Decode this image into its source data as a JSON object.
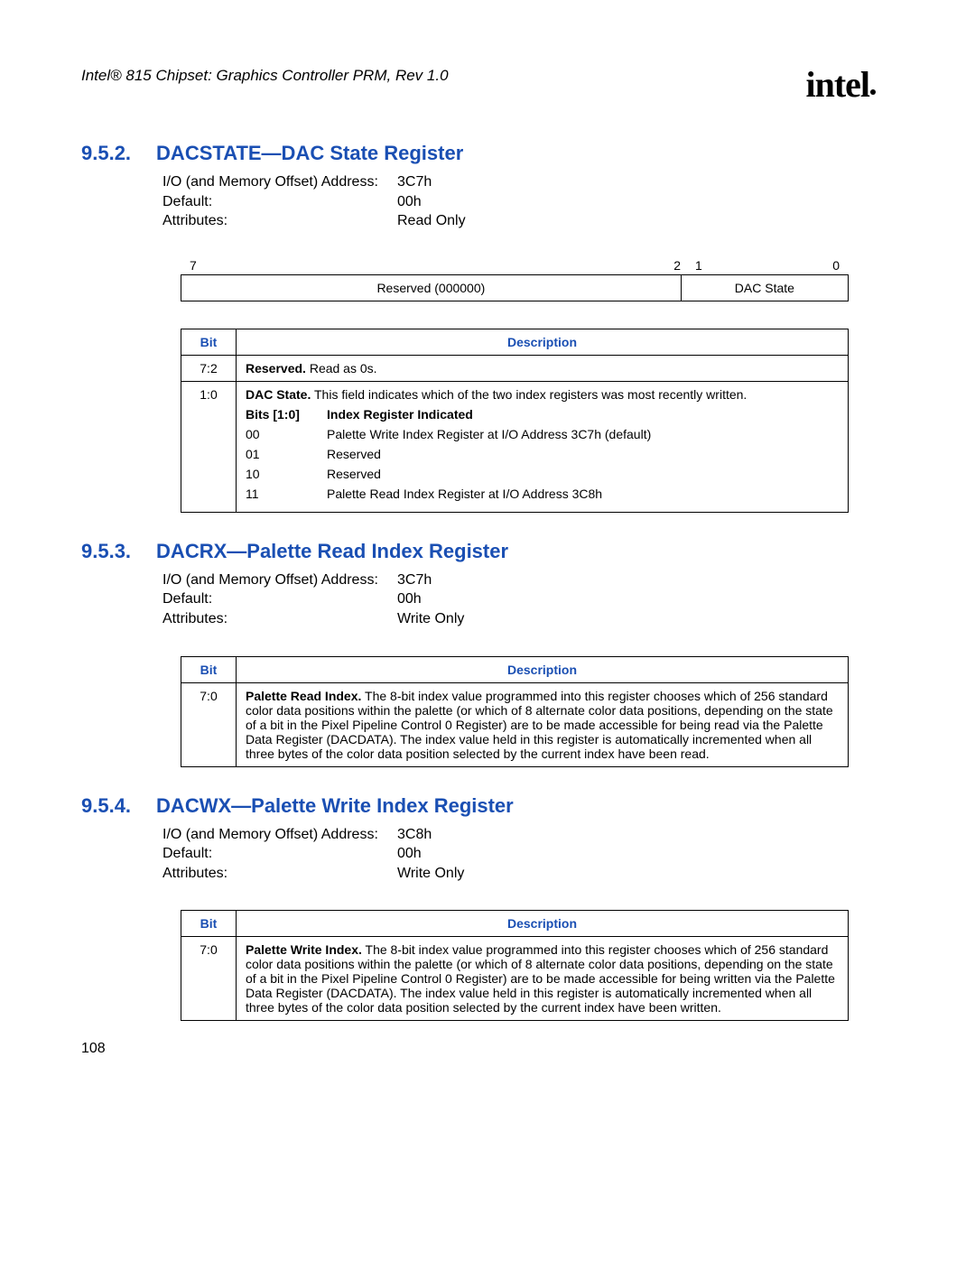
{
  "doc_header": "Intel® 815 Chipset: Graphics Controller PRM, Rev 1.0",
  "logo_text": "intel",
  "page_number": "108",
  "sections": {
    "s952": {
      "num": "9.5.2.",
      "title": "DACSTATE—DAC State Register",
      "meta": {
        "addr_label": "I/O (and Memory Offset) Address:",
        "addr_value": "3C7h",
        "default_label": "Default:",
        "default_value": "00h",
        "attr_label": "Attributes:",
        "attr_value": "Read Only"
      },
      "bitfield": {
        "b7": "7",
        "b2": "2",
        "b1": "1",
        "b0": "0",
        "reserved": "Reserved (000000)",
        "state": "DAC State"
      },
      "table": {
        "h_bit": "Bit",
        "h_desc": "Description",
        "row1_bit": "7:2",
        "row1_desc_bold": "Reserved.",
        "row1_desc_rest": " Read as 0s.",
        "row2_bit": "1:0",
        "row2_intro_bold": "DAC State.",
        "row2_intro_rest": " This field indicates which of the two index registers was most recently written.",
        "sub_h1": "Bits [1:0]",
        "sub_h2": "Index Register Indicated",
        "sub": [
          {
            "c1": "00",
            "c2": "Palette Write Index Register at I/O Address 3C7h (default)"
          },
          {
            "c1": "01",
            "c2": "Reserved"
          },
          {
            "c1": "10",
            "c2": "Reserved"
          },
          {
            "c1": "11",
            "c2": "Palette Read Index Register at I/O Address 3C8h"
          }
        ]
      }
    },
    "s953": {
      "num": "9.5.3.",
      "title": "DACRX—Palette Read Index Register",
      "meta": {
        "addr_label": "I/O (and Memory Offset) Address:",
        "addr_value": "3C7h",
        "default_label": "Default:",
        "default_value": "00h",
        "attr_label": "Attributes:",
        "attr_value": "Write Only"
      },
      "table": {
        "h_bit": "Bit",
        "h_desc": "Description",
        "row_bit": "7:0",
        "row_bold": "Palette Read Index.",
        "row_rest": " The 8-bit index value programmed into this register chooses which of 256 standard color data positions within the palette (or which of 8 alternate color data positions, depending on the state of a bit in the Pixel Pipeline Control 0 Register) are to be made accessible for being read via the Palette Data Register (DACDATA). The index value held in this register is automatically incremented when all three bytes of the color data position selected by the current index have been read."
      }
    },
    "s954": {
      "num": "9.5.4.",
      "title": "DACWX—Palette Write Index Register",
      "meta": {
        "addr_label": "I/O (and Memory Offset) Address:",
        "addr_value": "3C8h",
        "default_label": "Default:",
        "default_value": "00h",
        "attr_label": "Attributes:",
        "attr_value": "Write Only"
      },
      "table": {
        "h_bit": "Bit",
        "h_desc": "Description",
        "row_bit": "7:0",
        "row_bold": "Palette Write Index.",
        "row_rest": " The 8-bit index value programmed into this register chooses which of 256 standard color data positions within the palette (or which of 8 alternate color data positions, depending on the state of a bit in the Pixel Pipeline Control 0 Register) are to be made accessible for being written via the Palette Data Register (DACDATA). The index value held in this register is automatically incremented when all three bytes of the color data position selected by the current index have been written."
      }
    }
  }
}
